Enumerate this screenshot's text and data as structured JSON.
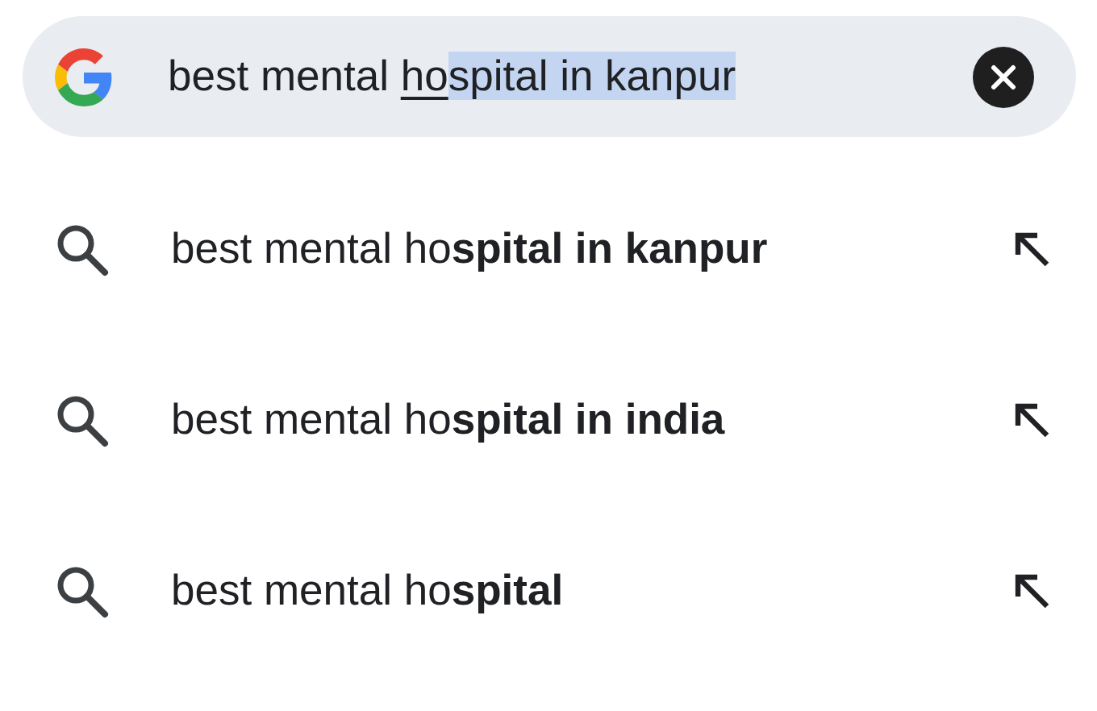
{
  "search_bar": {
    "query_segments": [
      {
        "text": "best mental ",
        "kind": "plain"
      },
      {
        "text": "ho",
        "kind": "composing"
      },
      {
        "text": "spital in kanpur",
        "kind": "selected"
      }
    ]
  },
  "suggestions": [
    {
      "text": "best mental ho**spital in kanpur**"
    },
    {
      "text": "best mental ho**spital in india**"
    },
    {
      "text": "best mental ho**spital**"
    }
  ]
}
